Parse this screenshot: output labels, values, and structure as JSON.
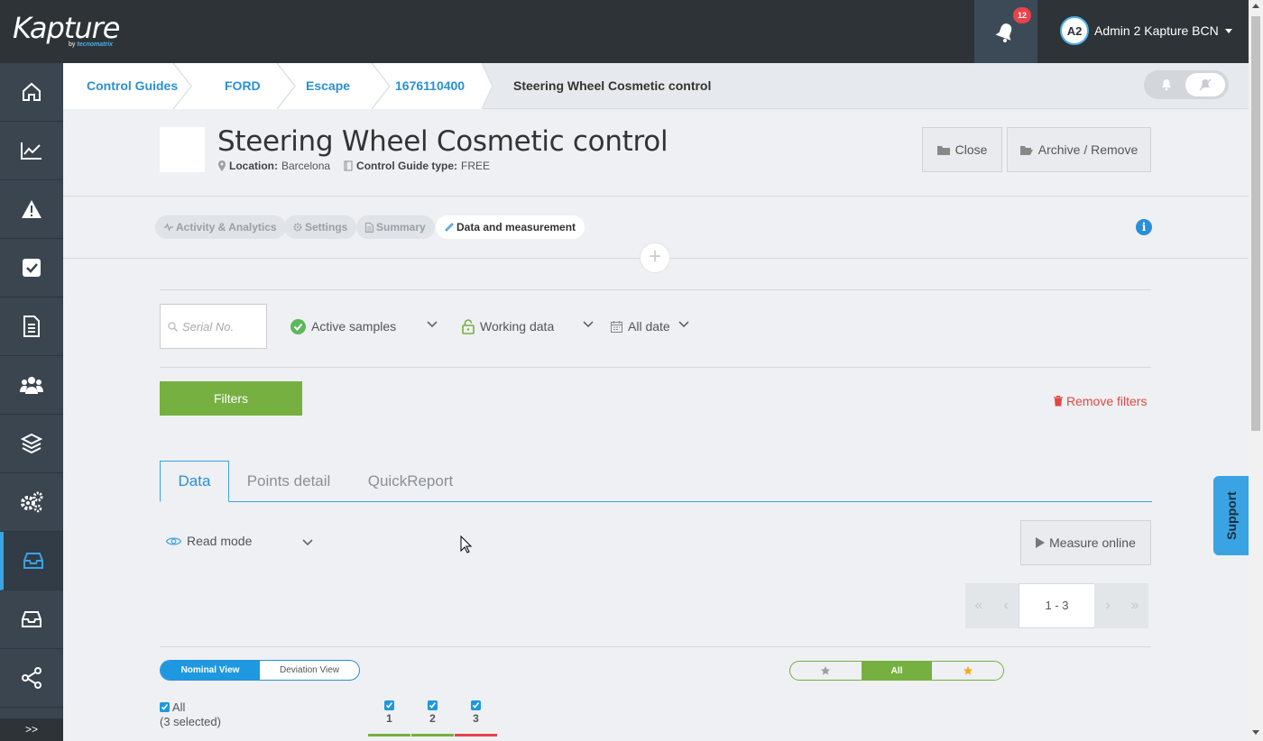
{
  "app": {
    "logo_text": "Kapture",
    "logo_by": "by",
    "logo_vendor": "tecnomatrix",
    "notification_count": "12",
    "user_initials": "A2",
    "user_name": "Admin 2 Kapture BCN"
  },
  "sidebar": {
    "items": [
      {
        "icon": "home-icon"
      },
      {
        "icon": "chart-line-icon"
      },
      {
        "icon": "warning-icon"
      },
      {
        "icon": "checkbox-icon"
      },
      {
        "icon": "document-icon"
      },
      {
        "icon": "users-icon"
      },
      {
        "icon": "layers-icon"
      },
      {
        "icon": "gears-icon"
      },
      {
        "icon": "inbox-icon",
        "active": true
      },
      {
        "icon": "archive-icon"
      },
      {
        "icon": "share-icon"
      }
    ],
    "expand_label": ">>"
  },
  "breadcrumb": {
    "items": [
      "Control Guides",
      "FORD",
      "Escape",
      "1676110400"
    ],
    "current": "Steering Wheel Cosmetic control"
  },
  "header": {
    "title": "Steering Wheel Cosmetic control",
    "location_label": "Location:",
    "location_value": "Barcelona",
    "type_label": "Control Guide type:",
    "type_value": "FREE",
    "close_label": "Close",
    "archive_label": "Archive / Remove"
  },
  "section_tabs": [
    {
      "label": "Activity & Analytics",
      "icon": "pulse-icon",
      "active": false
    },
    {
      "label": "Settings",
      "icon": "gear-icon",
      "active": false
    },
    {
      "label": "Summary",
      "icon": "file-icon",
      "active": false
    },
    {
      "label": "Data and measurement",
      "icon": "ruler-icon",
      "active": true
    }
  ],
  "filters": {
    "serial_placeholder": "Serial No.",
    "samples_label": "Active samples",
    "data_label": "Working data",
    "date_label": "All date",
    "filters_button": "Filters",
    "remove_filters": "Remove filters"
  },
  "data_tabs": {
    "items": [
      "Data",
      "Points detail",
      "QuickReport"
    ],
    "active": "Data"
  },
  "toolbar": {
    "read_mode": "Read mode",
    "measure_online": "Measure online",
    "pager_range": "1 - 3"
  },
  "view": {
    "nominal": "Nominal View",
    "deviation": "Deviation View",
    "star_filter_all": "All",
    "all_label": "All",
    "selected_label": "(3 selected)",
    "columns": [
      "1",
      "2",
      "3"
    ]
  },
  "support_label": "Support",
  "colors": {
    "accent_blue": "#2a8fd6",
    "green": "#76b041",
    "red": "#e8424d",
    "topbar": "#2e3338",
    "sidebar": "#3a4550"
  }
}
